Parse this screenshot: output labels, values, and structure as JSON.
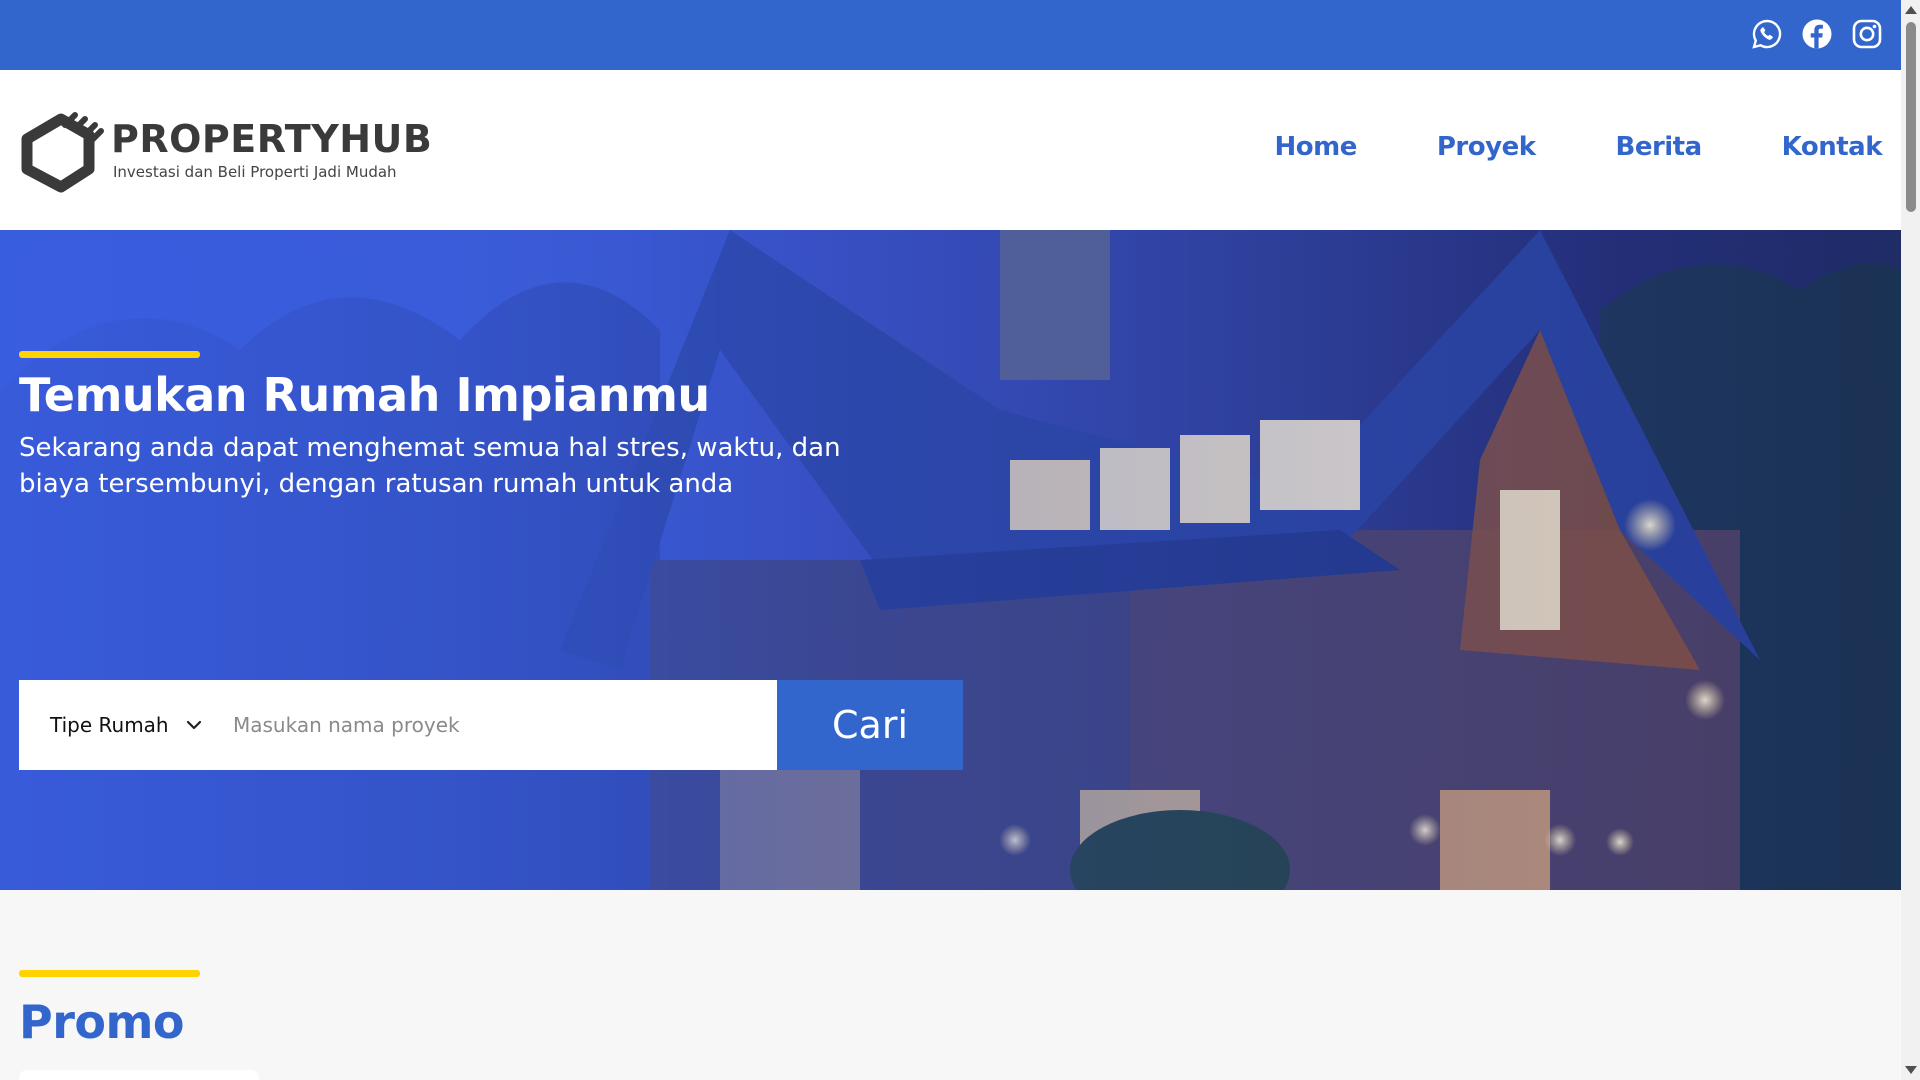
{
  "topbar": {
    "social_icons": [
      "whatsapp-icon",
      "facebook-icon",
      "instagram-icon"
    ],
    "background": "#3366cc"
  },
  "header": {
    "logo": {
      "name": "PROPERTYHUB",
      "tagline": "Investasi dan Beli Properti Jadi Mudah"
    },
    "nav": [
      {
        "label": "Home"
      },
      {
        "label": "Proyek"
      },
      {
        "label": "Berita"
      },
      {
        "label": "Kontak"
      }
    ]
  },
  "hero": {
    "title": "Temukan Rumah Impianmu",
    "subtitle": "Sekarang anda dapat menghemat semua hal stres, waktu, dan biaya tersembunyi, dengan ratusan rumah untuk anda",
    "search": {
      "select_label": "Tipe Rumah",
      "input_placeholder": "Masukan nama proyek",
      "input_value": "",
      "button_label": "Cari"
    }
  },
  "promo": {
    "title": "Promo"
  },
  "colors": {
    "primary": "#3366cc",
    "accent": "#ffd200",
    "text_dark": "#3a3a3a"
  }
}
